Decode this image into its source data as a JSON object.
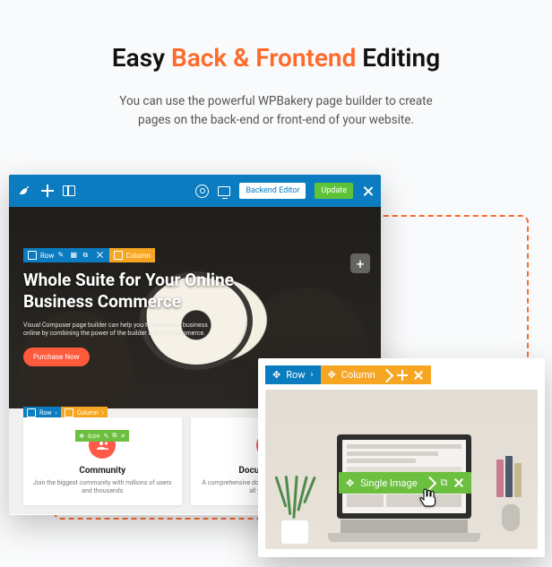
{
  "header": {
    "title_pre": "Easy ",
    "title_accent": "Back & Frontend",
    "title_post": " Editing",
    "subtitle_l1": "You can use the powerful WPBakery page builder to create",
    "subtitle_l2": "pages on the back-end or front-end of your website."
  },
  "topbar": {
    "backend_editor": "Backend Editor",
    "update": "Update"
  },
  "hero": {
    "row_label": "Row",
    "col_label": "Column",
    "heading_l1": "Whole Suite for Your Online",
    "heading_l2": "Business Commerce",
    "para": "Visual Composer page builder can help you to move your business online by combining the power of the builder and WooCommerce.",
    "purchase": "Purchase Now"
  },
  "cards": {
    "row_label": "Row",
    "col_label": "Column",
    "icon_label": "Icon",
    "items": [
      {
        "title": "Community",
        "desc": "Join the biggest community with millions of users and thousands"
      },
      {
        "title": "Documentation",
        "desc": "A comprehensive documentation that addresses all you need to"
      }
    ]
  },
  "small": {
    "row": "Row",
    "column": "Column",
    "single_image": "Single Image"
  }
}
